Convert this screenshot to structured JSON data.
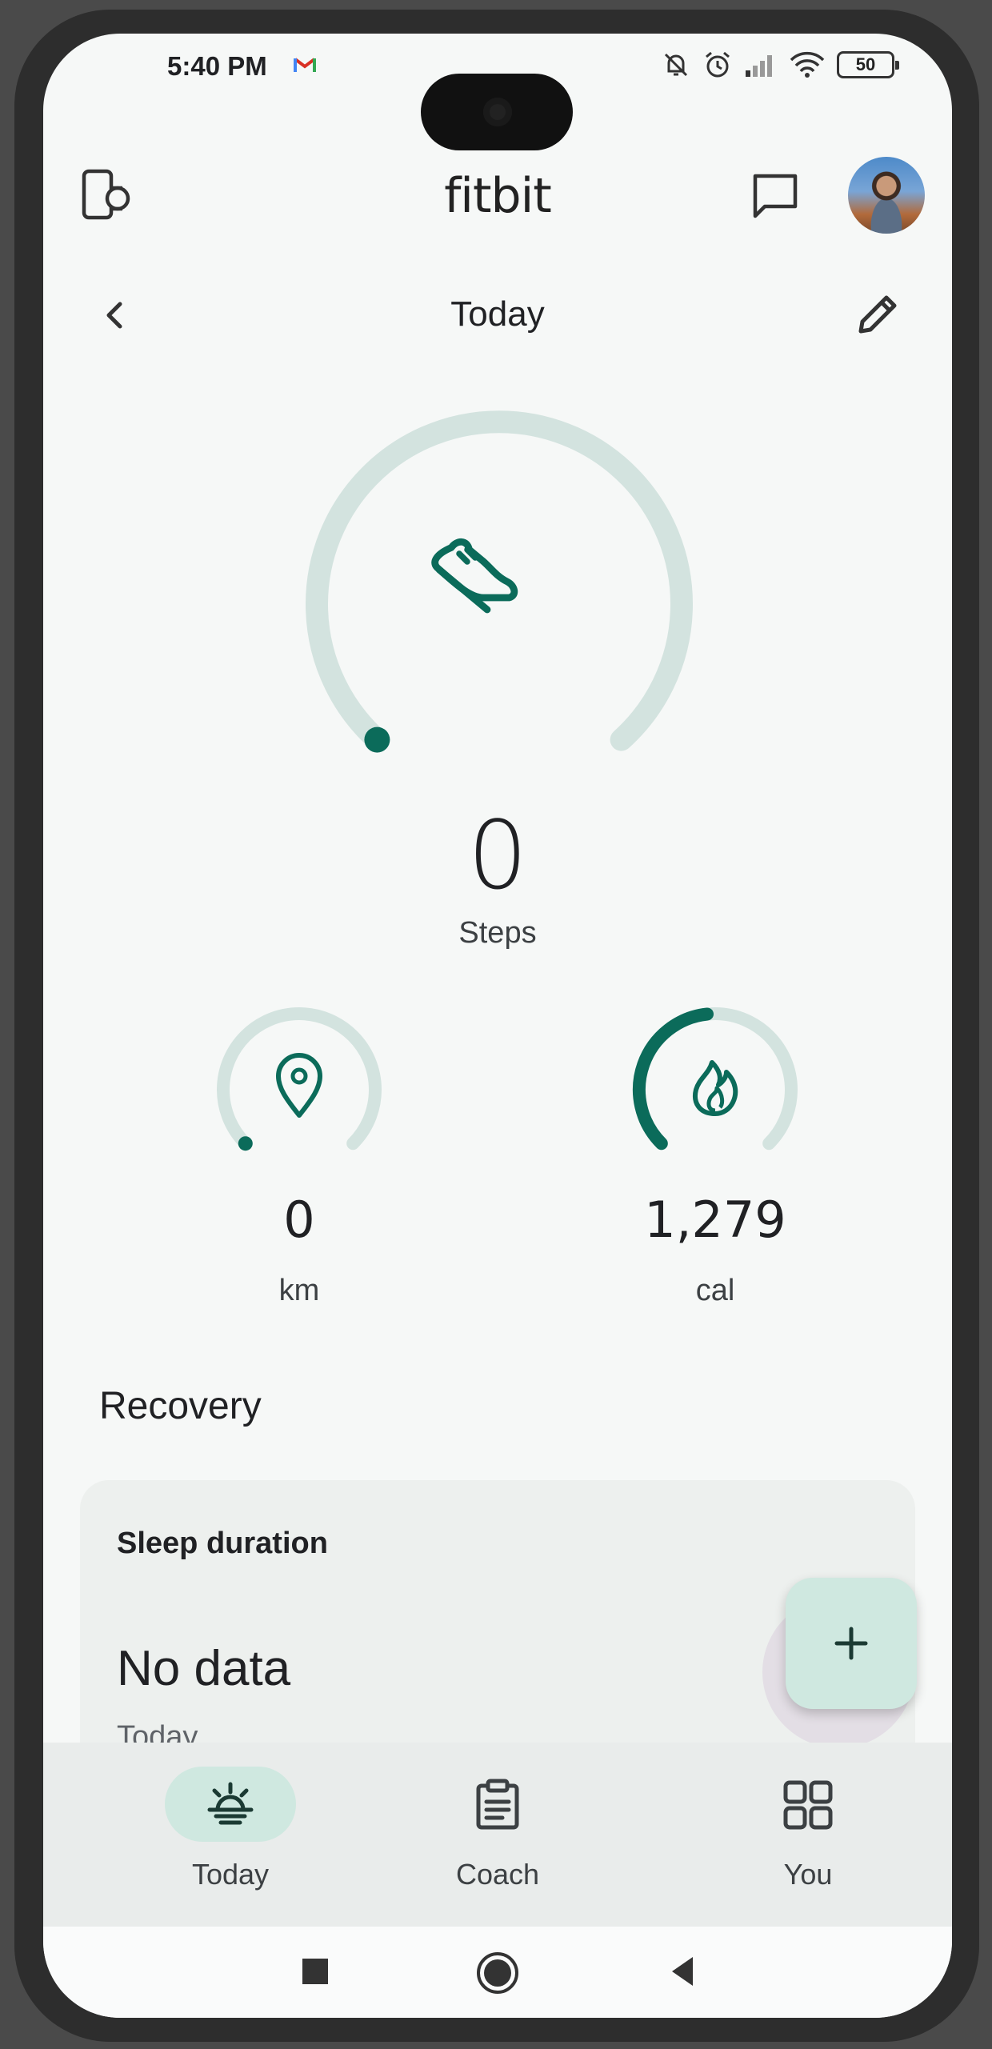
{
  "status_bar": {
    "time": "5:40 PM",
    "battery": "50"
  },
  "header": {
    "logo": "fitbit"
  },
  "date": {
    "title": "Today"
  },
  "steps": {
    "value": "0",
    "label": "Steps",
    "progress": 0
  },
  "distance": {
    "value": "0",
    "unit": "km",
    "progress": 0
  },
  "calories": {
    "value": "1,279",
    "unit": "cal",
    "progress": 0.4
  },
  "recovery": {
    "title": "Recovery",
    "card": {
      "title": "Sleep duration",
      "value": "No data",
      "date": "Today"
    }
  },
  "nav": {
    "items": [
      {
        "label": "Today",
        "icon": "sunrise-icon",
        "active": true
      },
      {
        "label": "Coach",
        "icon": "clipboard-icon",
        "active": false
      },
      {
        "label": "You",
        "icon": "grid-icon",
        "active": false
      }
    ]
  },
  "colors": {
    "accent": "#0b6b5a",
    "track": "#d3e3df",
    "pill": "#cfe8e0"
  }
}
